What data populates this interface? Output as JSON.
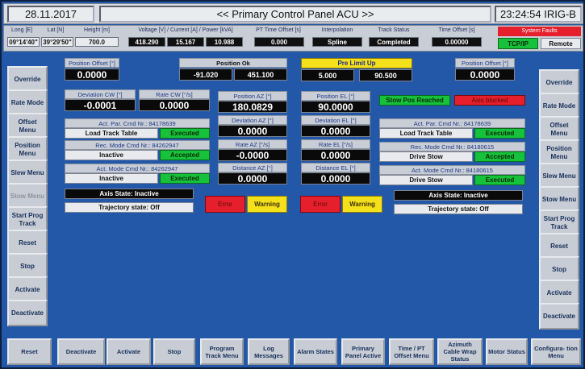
{
  "header": {
    "date": "28.11.2017",
    "title": "<< Primary Control Panel ACU >>",
    "time": "23:24:54 IRIG-B"
  },
  "status": {
    "long_label": "Long [E]",
    "lat_label": "Lat [N]",
    "height_label": "Height [m]",
    "long_value": "09°14'40\"",
    "lat_value": "39°29'50\"",
    "height_value": "700.0",
    "vip_label": "Voltage [V]  /  Current [A]  /  Power [kVA]",
    "voltage": "418.290",
    "current": "15.167",
    "power": "10.988",
    "pt_label": "PT Time Offset [s]",
    "pt_value": "0.000",
    "interp_label": "Interpolation",
    "interp_value": "Spline",
    "track_label": "Track Status",
    "track_value": "Completed",
    "toff_label": "Time Offset [s]",
    "toff_value": "0.00000",
    "faults_label": "System Faults",
    "tcpip": "TCP/IP",
    "remote": "Remote"
  },
  "left_menu": [
    "Override",
    "Rate Mode",
    "Offset Menu",
    "Position Menu",
    "Slew Menu",
    "Stow Menu",
    "Start Prog Track",
    "Reset",
    "Stop",
    "Activate",
    "Deactivate"
  ],
  "right_menu": [
    "Override",
    "Rate Mode",
    "Offset Menu",
    "Position Menu",
    "Slew Menu",
    "Stow Menu",
    "Start Prog Track",
    "Reset",
    "Stop",
    "Activate",
    "Deactivate"
  ],
  "bottom_menu": [
    "Reset",
    "Deactivate",
    "Activate",
    "Stop",
    "Program Track Menu",
    "Log Messages",
    "Alarm States",
    "Primary Panel Active",
    "Time / PT Offset Menu",
    "Azimuth Cable Wrap Status",
    "Motor Status",
    "Configura- tion Menu"
  ],
  "az": {
    "pos_offset_label": "Position Offset [°]",
    "pos_offset": "0.0000",
    "dev_cw_label": "Deviation CW [°]",
    "dev_cw": "-0.0001",
    "rate_cw_label": "Rate CW [°/s]",
    "rate_cw": "0.0000",
    "par_cmd": "Act. Par. Cmd Nr.: 84178639",
    "par_name": "Load Track Table",
    "par_state": "Executed",
    "rec_cmd": "Rec. Mode Cmd Nr.: 84262947",
    "rec_name": "Inactive",
    "rec_state": "Accepted",
    "act_cmd": "Act. Mode Cmd Nr.: 84262947",
    "act_name": "Inactive",
    "act_state": "Executed",
    "axis_state": "Axis State: Inactive",
    "traj_state": "Trajectory state: Off",
    "error": "Error",
    "warning": "Warning"
  },
  "center": {
    "pos_ok_label": "Position Ok",
    "pos_ok_az": "-91.020",
    "pos_ok_el": "451.100",
    "pos_az_label": "Position AZ [°]",
    "pos_az": "180.0829",
    "dev_az_label": "Deviation AZ [°]",
    "dev_az": "0.0000",
    "rate_az_label": "Rate AZ [°/s]",
    "rate_az": "-0.0000",
    "dist_az_label": "Distance AZ [°]",
    "dist_az": "0.0000",
    "pre_limit_label": "Pre Limit Up",
    "pre_limit_a": "5.000",
    "pre_limit_b": "90.500",
    "pos_el_label": "Position EL [°]",
    "pos_el": "90.0000",
    "dev_el_label": "Deviation EL [°]",
    "dev_el": "0.0000",
    "rate_el_label": "Rate EL [°/s]",
    "rate_el": "0.0000",
    "dist_el_label": "Distance EL [°]",
    "dist_el": "0.0000"
  },
  "el": {
    "pos_offset_label": "Position Offset [°]",
    "pos_offset": "0.0000",
    "stow_reached": "Stow Pos Reached",
    "axis_blocked": "Axis blocked",
    "par_cmd": "Act. Par. Cmd Nr.: 84178639",
    "par_name": "Load Track Table",
    "par_state": "Executed",
    "rec_cmd": "Rec. Mode Cmd Nr.: 84180615",
    "rec_name": "Drive Stow",
    "rec_state": "Accepted",
    "act_cmd": "Act. Mode Cmd Nr.: 84180615",
    "act_name": "Drive Stow",
    "act_state": "Executed",
    "axis_state": "Axis State: Inactive",
    "traj_state": "Trajectory state: Off",
    "error": "Error",
    "warning": "Warning"
  },
  "colors": {
    "panel": "#2358a8",
    "ok_green": "#17c23b",
    "alarm_red": "#e61f2c",
    "warn_yellow": "#f5e01c"
  }
}
